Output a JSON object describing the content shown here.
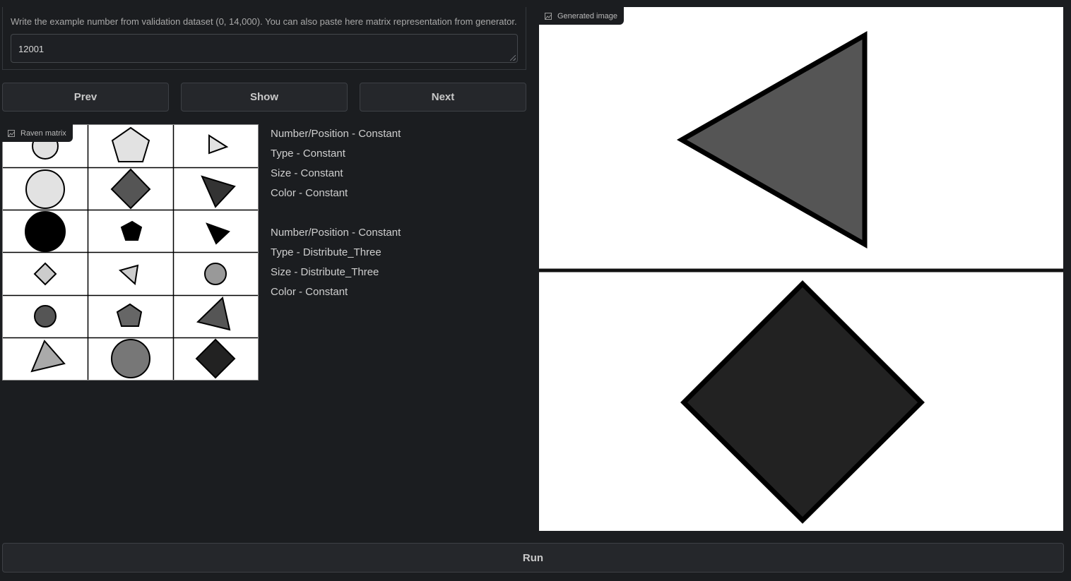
{
  "input": {
    "label": "Write the example number from validation dataset (0, 14,000). You can also paste here matrix representation from generator.",
    "value": "12001"
  },
  "buttons": {
    "prev": "Prev",
    "show": "Show",
    "next": "Next",
    "run": "Run"
  },
  "raven_panel": {
    "badge_label": "Raven matrix",
    "badge_icon": "image-icon"
  },
  "generated_panel": {
    "badge_label": "Generated image",
    "badge_icon": "image-icon"
  },
  "rules": {
    "group1": [
      "Number/Position - Constant",
      "Type - Constant",
      "Size - Constant",
      "Color - Constant"
    ],
    "group2": [
      "Number/Position - Constant",
      "Type - Distribute_Three",
      "Size - Distribute_Three",
      "Color - Constant"
    ]
  },
  "colors": {
    "background": "#1b1d20",
    "button_bg": "#25272b",
    "text": "#c9c9c9"
  }
}
